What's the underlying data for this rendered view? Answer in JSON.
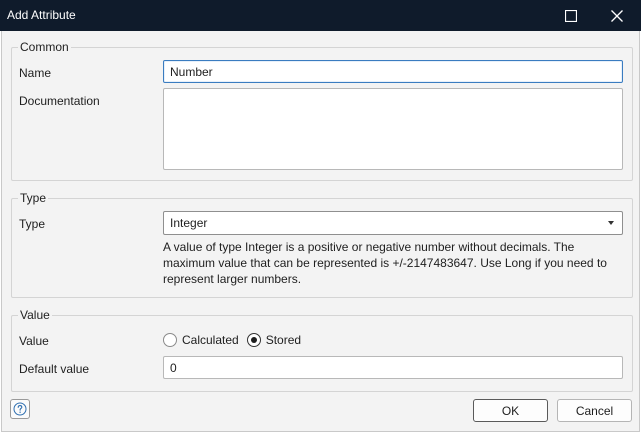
{
  "window": {
    "title": "Add Attribute",
    "maximize_icon": "maximize-icon",
    "close_icon": "close-icon"
  },
  "common": {
    "legend": "Common",
    "name_label": "Name",
    "name_value": "Number",
    "documentation_label": "Documentation",
    "documentation_value": ""
  },
  "type_group": {
    "legend": "Type",
    "type_label": "Type",
    "type_value": "Integer",
    "description": "A value of type Integer is a positive or negative number without decimals. The maximum value that can be represented is +/-2147483647. Use Long if you need to represent larger numbers."
  },
  "value_group": {
    "legend": "Value",
    "value_label": "Value",
    "options": [
      {
        "label": "Calculated",
        "checked": false
      },
      {
        "label": "Stored",
        "checked": true
      }
    ],
    "default_label": "Default value",
    "default_value": "0"
  },
  "footer": {
    "help_icon": "help-icon",
    "ok_label": "OK",
    "cancel_label": "Cancel"
  },
  "colors": {
    "titlebar_bg": "#0f1b2b",
    "dialog_bg": "#f3f3f3",
    "focus_border": "#3a7cc0"
  }
}
